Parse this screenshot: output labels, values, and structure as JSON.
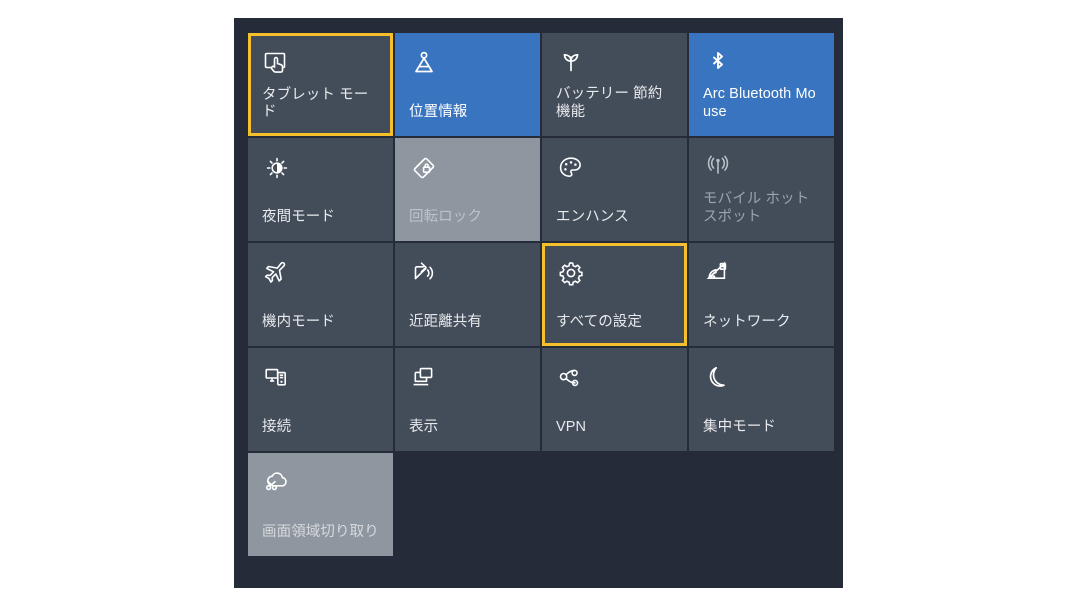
{
  "panel": {
    "name": "Windows Action Center quick actions panel",
    "background_color": "#252b38",
    "accent_color": "#3874bf",
    "focus_outline_color": "#f5c02b",
    "tile_color": "#434c59",
    "hover_tile_color": "#8e979f"
  },
  "tiles": [
    {
      "id": "tablet-mode",
      "label": "タブレット モード",
      "icon": "tablet-mode-icon",
      "state": "off",
      "focused": true,
      "disabled": false,
      "hover": false
    },
    {
      "id": "location",
      "label": "位置情報",
      "icon": "location-pin-icon",
      "state": "on",
      "focused": false,
      "disabled": false,
      "hover": false
    },
    {
      "id": "battery-saver",
      "label": "バッテリー 節約機能",
      "icon": "battery-saver-leaf-icon",
      "state": "off",
      "focused": false,
      "disabled": false,
      "hover": false
    },
    {
      "id": "arc-bluetooth-mouse",
      "label": "Arc Bluetooth Mouse",
      "icon": "bluetooth-icon",
      "state": "on",
      "focused": false,
      "disabled": false,
      "hover": false
    },
    {
      "id": "night-light",
      "label": "夜間モード",
      "icon": "night-light-sun-icon",
      "state": "off",
      "focused": false,
      "disabled": false,
      "hover": false
    },
    {
      "id": "rotation-lock",
      "label": "回転ロック",
      "icon": "rotation-lock-icon",
      "state": "off",
      "focused": false,
      "disabled": true,
      "hover": true
    },
    {
      "id": "enhance",
      "label": "エンハンス",
      "icon": "palette-icon",
      "state": "off",
      "focused": false,
      "disabled": false,
      "hover": false
    },
    {
      "id": "mobile-hotspot",
      "label": "モバイル ホットスポット",
      "icon": "hotspot-broadcast-icon",
      "state": "off",
      "focused": false,
      "disabled": true,
      "hover": false
    },
    {
      "id": "airplane-mode",
      "label": "機内モード",
      "icon": "airplane-icon",
      "state": "off",
      "focused": false,
      "disabled": false,
      "hover": false
    },
    {
      "id": "nearby-sharing",
      "label": "近距離共有",
      "icon": "nearby-share-icon",
      "state": "off",
      "focused": false,
      "disabled": false,
      "hover": false
    },
    {
      "id": "all-settings",
      "label": "すべての設定",
      "icon": "gear-icon",
      "state": "off",
      "focused": true,
      "disabled": false,
      "hover": false
    },
    {
      "id": "network",
      "label": "ネットワーク",
      "icon": "network-wifi-icon",
      "state": "off",
      "focused": false,
      "disabled": false,
      "hover": false
    },
    {
      "id": "connect",
      "label": "接続",
      "icon": "connect-devices-icon",
      "state": "off",
      "focused": false,
      "disabled": false,
      "hover": false
    },
    {
      "id": "project",
      "label": "表示",
      "icon": "project-display-icon",
      "state": "off",
      "focused": false,
      "disabled": false,
      "hover": false
    },
    {
      "id": "vpn",
      "label": "VPN",
      "icon": "vpn-icon",
      "state": "off",
      "focused": false,
      "disabled": false,
      "hover": false
    },
    {
      "id": "focus-assist",
      "label": "集中モード",
      "icon": "moon-icon",
      "state": "off",
      "focused": false,
      "disabled": false,
      "hover": false
    },
    {
      "id": "screen-snip",
      "label": "画面領域切り取り",
      "icon": "screen-snip-icon",
      "state": "off",
      "focused": false,
      "disabled": false,
      "hover": true
    }
  ]
}
